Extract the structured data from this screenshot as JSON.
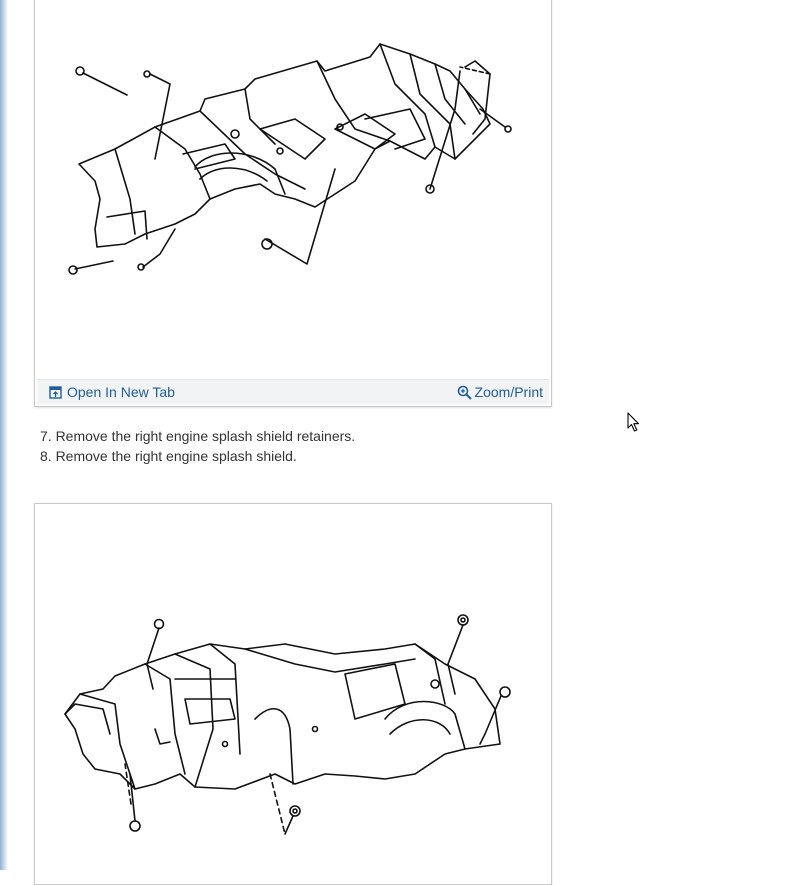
{
  "figures": [
    {
      "open_label": "Open In New Tab",
      "zoom_label": "Zoom/Print"
    },
    {}
  ],
  "steps": [
    "7. Remove the right engine splash shield retainers.",
    "8. Remove the right engine splash shield."
  ]
}
